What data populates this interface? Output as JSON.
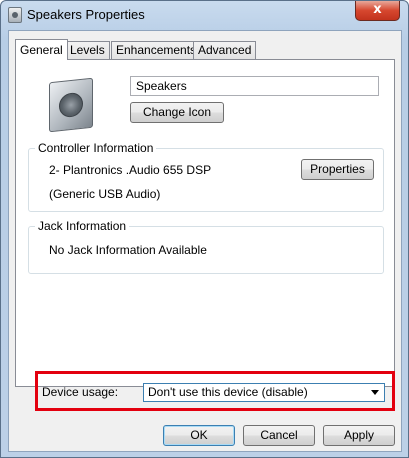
{
  "window": {
    "title": "Speakers Properties",
    "close_glyph": "x"
  },
  "tabs": [
    {
      "label": "General",
      "active": true
    },
    {
      "label": "Levels",
      "active": false
    },
    {
      "label": "Enhancements",
      "active": false
    },
    {
      "label": "Advanced",
      "active": false
    }
  ],
  "general": {
    "device_icon": "speaker-icon",
    "device_name": "Speakers",
    "change_icon_label": "Change Icon"
  },
  "controller": {
    "heading": "Controller Information",
    "name": "2- Plantronics .Audio 655 DSP",
    "description": "(Generic USB Audio)",
    "properties_label": "Properties"
  },
  "jack": {
    "heading": "Jack Information",
    "message": "No Jack Information Available"
  },
  "device_usage": {
    "label": "Device usage:",
    "selected": "Don't use this device (disable)",
    "highlight_color": "#e3000f"
  },
  "footer": {
    "ok_label": "OK",
    "cancel_label": "Cancel",
    "apply_label": "Apply"
  }
}
